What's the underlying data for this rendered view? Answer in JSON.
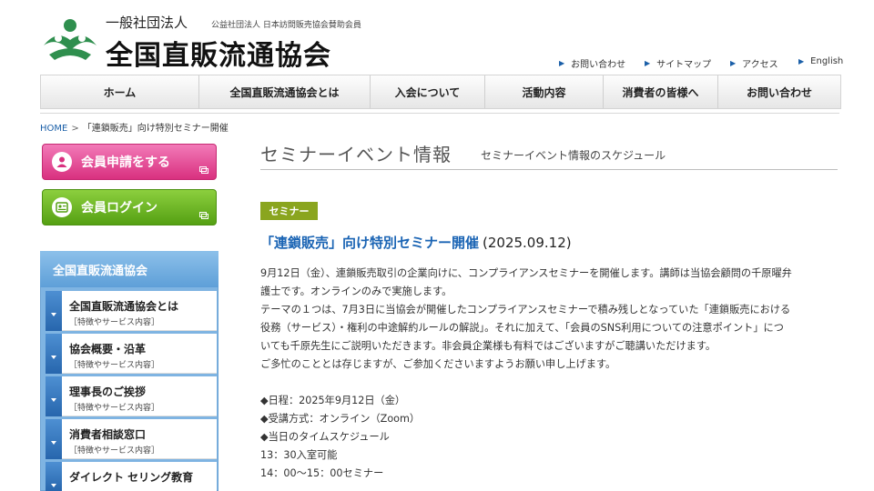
{
  "header": {
    "org_type": "一般社団法人",
    "member_note": "公益社団法人 日本訪問販売協会賛助会員",
    "org_name": "全国直販流通協会"
  },
  "utility_links": [
    {
      "label": "お問い合わせ"
    },
    {
      "label": "サイトマップ"
    },
    {
      "label": "アクセス"
    },
    {
      "label": "English"
    }
  ],
  "nav": [
    {
      "label": "ホーム"
    },
    {
      "label": "全国直販流通協会とは"
    },
    {
      "label": "入会について"
    },
    {
      "label": "活動内容"
    },
    {
      "label": "消費者の皆様へ"
    },
    {
      "label": "お問い合わせ"
    }
  ],
  "breadcrumb": {
    "home": "HOME",
    "sep": ">",
    "current": "「連鎖販売」向け特別セミナー開催"
  },
  "sidebar": {
    "apply_label": "会員申請をする",
    "login_label": "会員ログイン",
    "section_title": "全国直販流通協会",
    "items": [
      {
        "title": "全国直販流通協会とは",
        "sub": "［特徴やサービス内容］"
      },
      {
        "title": "協会概要・沿革",
        "sub": "［特徴やサービス内容］"
      },
      {
        "title": "理事長のご挨拶",
        "sub": "［特徴やサービス内容］"
      },
      {
        "title": "消費者相談窓口",
        "sub": "［特徴やサービス内容］"
      },
      {
        "title": "ダイレクト セリング教育",
        "sub": ""
      }
    ]
  },
  "main": {
    "title": "セミナーイベント情報",
    "subtitle": "セミナーイベント情報のスケジュール",
    "category": "セミナー",
    "headline": "「連鎖販売」向け特別セミナー開催",
    "date": "(2025.09.12)",
    "lines": [
      "9月12日（金）、連鎖販売取引の企業向けに、コンプライアンスセミナーを開催します。講師は当協会顧問の千原曜弁",
      "護士です。オンラインのみで実施します。",
      "テーマの１つは、7月3日に当協会が開催したコンプライアンスセミナーで積み残しとなっていた「連鎖販売における",
      "役務（サービス）・権利の中途解約ルールの解説」。それに加えて、「会員のSNS利用についての注意ポイント」につ",
      "いても千原先生にご説明いただきます。非会員企業様も有料ではございますがご聴講いただけます。",
      "ご多忙のこととは存じますが、ご参加くださいますようお願い申し上げます。",
      "",
      "◆日程：2025年9月12日（金）",
      "◆受講方式：オンライン（Zoom）",
      "◆当日のタイムスケジュール",
      "13：30入室可能",
      "14：00〜15：00セミナー"
    ]
  },
  "colors": {
    "link_blue": "#1a64b4",
    "badge_green": "#8aa51f",
    "logo_green": "#2f8f4e",
    "sidebar_blue": "#5e9fd8",
    "pink": "#d9307f",
    "green": "#55a013"
  }
}
